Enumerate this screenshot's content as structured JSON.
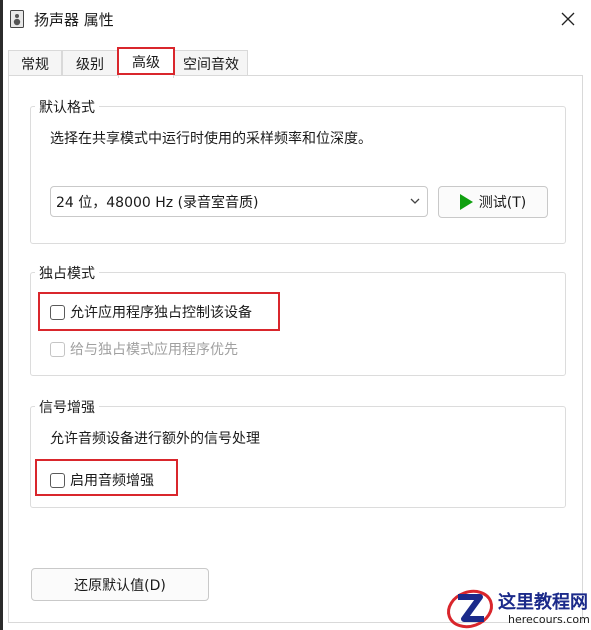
{
  "window": {
    "title": "扬声器 属性"
  },
  "tabs": [
    {
      "label": "常规"
    },
    {
      "label": "级别"
    },
    {
      "label": "高级"
    },
    {
      "label": "空间音效"
    }
  ],
  "active_tab": "高级",
  "default_format": {
    "group_label": "默认格式",
    "description": "选择在共享模式中运行时使用的采样频率和位深度。",
    "selected_value": "24 位，48000 Hz (录音室音质)",
    "test_button_label": "测试(T)"
  },
  "exclusive_mode": {
    "group_label": "独占模式",
    "allow_exclusive_label": "允许应用程序独占控制该设备",
    "allow_exclusive_checked": false,
    "priority_label": "给与独占模式应用程序优先",
    "priority_checked": false,
    "priority_enabled": false
  },
  "signal_enhancement": {
    "group_label": "信号增强",
    "description": "允许音频设备进行额外的信号处理",
    "enable_label": "启用音频增强",
    "enable_checked": false
  },
  "restore_button_label": "还原默认值(D)",
  "watermark": {
    "title": "这里教程网",
    "subtitle": "herecours.com"
  },
  "colors": {
    "highlight_red": "#d9262c",
    "play_green": "#10a010",
    "watermark_blue": "#1b2a8a"
  }
}
